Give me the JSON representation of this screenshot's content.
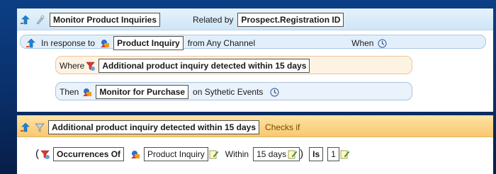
{
  "rule": {
    "name": "Monitor Product Inquiries",
    "related_by_label": "Related by",
    "related_by_value": "Prospect.Registration ID",
    "in_response_label": "In response to",
    "event": "Product Inquiry",
    "from_label": "from Any Channel",
    "when_label": "When",
    "where_label": "Where",
    "where_condition": "Additional  product inquiry detected within 15 days",
    "then_label": "Then",
    "action": "Monitor for Purchase",
    "on_label": "on Sythetic Events"
  },
  "condition": {
    "name": "Additional  product inquiry detected within 15 days",
    "checks_label": "Checks if",
    "open_paren": "(",
    "function": "Occurrences Of",
    "event": "Product Inquiry",
    "within_label": "Within",
    "period": "15 days",
    "close_paren": ")",
    "is_label": "Is",
    "count": "1"
  },
  "colors": {
    "background": "#0a2f68",
    "header_blue": "#cfe6f7",
    "header_orange": "#f8c871"
  }
}
